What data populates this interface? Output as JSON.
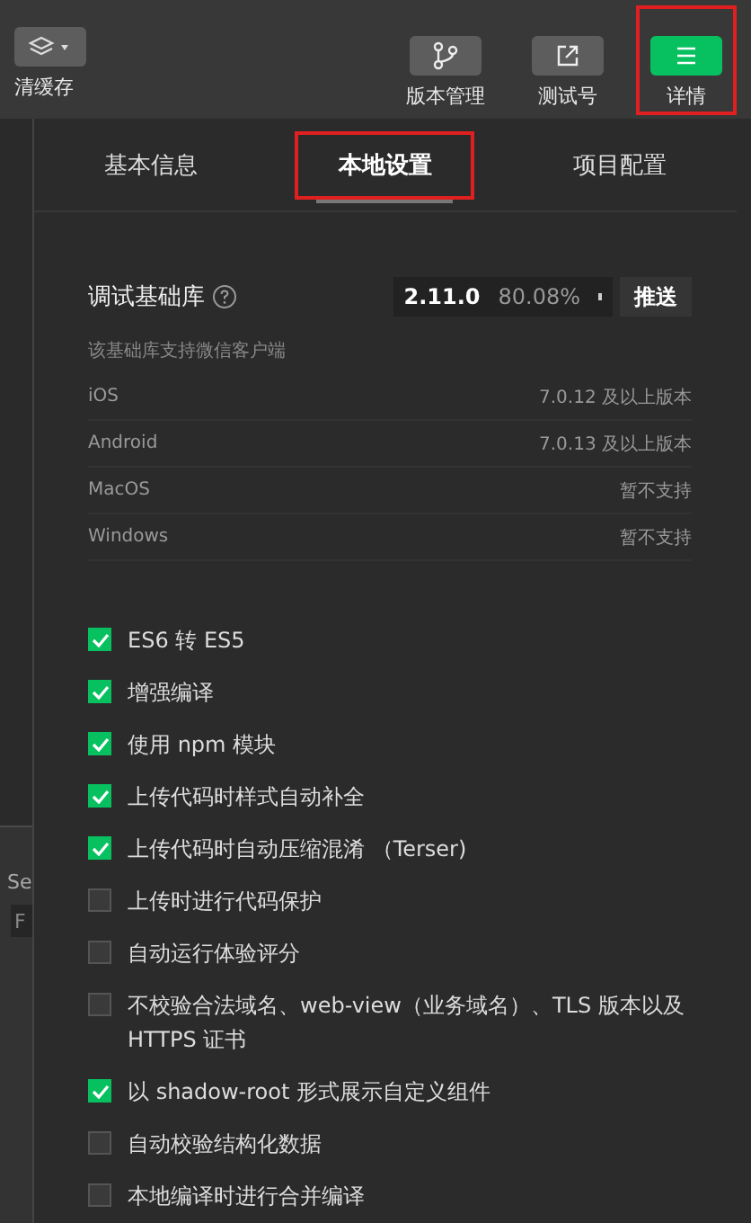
{
  "toolbar": {
    "left": {
      "label": "清缓存"
    },
    "buttons": [
      {
        "label": "版本管理",
        "kind": "branch",
        "active": false,
        "highlighted": false
      },
      {
        "label": "测试号",
        "kind": "external",
        "active": false,
        "highlighted": false
      },
      {
        "label": "详情",
        "kind": "menu",
        "active": true,
        "highlighted": true
      }
    ]
  },
  "left_pane": {
    "texts": [
      "Se",
      "F"
    ]
  },
  "tabs": [
    {
      "label": "基本信息",
      "selected": false,
      "highlighted": false
    },
    {
      "label": "本地设置",
      "selected": true,
      "highlighted": true
    },
    {
      "label": "项目配置",
      "selected": false,
      "highlighted": false
    }
  ],
  "debug_lib": {
    "label": "调试基础库",
    "version": "2.11.0",
    "share": "80.08%",
    "push": "推送"
  },
  "support": {
    "title": "该基础库支持微信客户端",
    "rows": [
      {
        "name": "iOS",
        "value": "7.0.12 及以上版本"
      },
      {
        "name": "Android",
        "value": "7.0.13 及以上版本"
      },
      {
        "name": "MacOS",
        "value": "暂不支持"
      },
      {
        "name": "Windows",
        "value": "暂不支持"
      }
    ]
  },
  "options": [
    {
      "label": "ES6 转 ES5",
      "checked": true
    },
    {
      "label": "增强编译",
      "checked": true
    },
    {
      "label": "使用 npm 模块",
      "checked": true
    },
    {
      "label": "上传代码时样式自动补全",
      "checked": true
    },
    {
      "label": "上传代码时自动压缩混淆 （Terser)",
      "checked": true
    },
    {
      "label": "上传时进行代码保护",
      "checked": false
    },
    {
      "label": "自动运行体验评分",
      "checked": false
    },
    {
      "label": "不校验合法域名、web-view（业务域名）、TLS 版本以及 HTTPS 证书",
      "checked": false
    },
    {
      "label": "以 shadow-root 形式展示自定义组件",
      "checked": true
    },
    {
      "label": "自动校验结构化数据",
      "checked": false
    },
    {
      "label": "本地编译时进行合并编译",
      "checked": false
    }
  ]
}
